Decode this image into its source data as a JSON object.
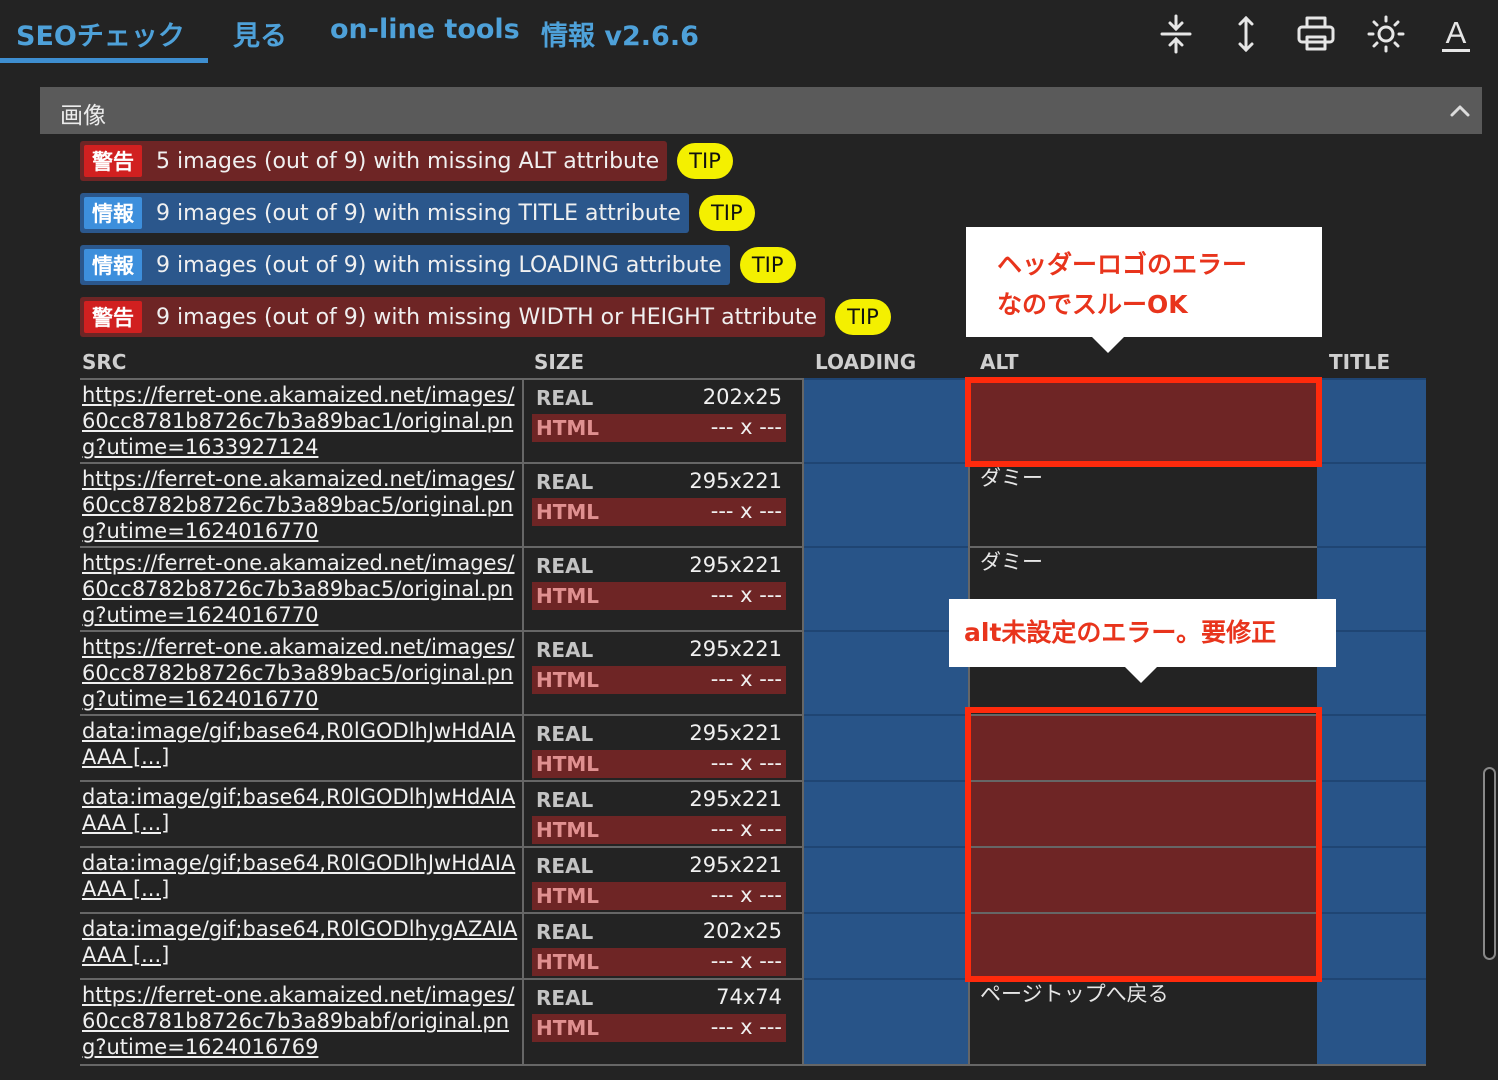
{
  "tabs": [
    "SEOチェック",
    "見る",
    "on-line tools",
    "情報 v2.6.6"
  ],
  "toolbar": [
    "collapse-vertical-icon",
    "expand-vertical-icon",
    "print-icon",
    "brightness-icon",
    "font-icon"
  ],
  "toolbar_font_glyph": "A",
  "section": {
    "title": "画像"
  },
  "messages": [
    {
      "type": "warn",
      "badge": "警告",
      "text": "5 images (out of 9) with missing ALT attribute",
      "tip": "TIP"
    },
    {
      "type": "info",
      "badge": "情報",
      "text": "9 images (out of 9) with missing TITLE attribute",
      "tip": "TIP"
    },
    {
      "type": "info",
      "badge": "情報",
      "text": "9 images (out of 9) with missing LOADING attribute",
      "tip": "TIP"
    },
    {
      "type": "warn",
      "badge": "警告",
      "text": "9 images (out of 9) with missing WIDTH or HEIGHT attribute",
      "tip": "TIP"
    }
  ],
  "table": {
    "headers": {
      "src": "SRC",
      "size": "SIZE",
      "loading": "LOADING",
      "alt": "ALT",
      "title": "TITLE"
    },
    "size_labels": {
      "real": "REAL",
      "html": "HTML"
    },
    "rows": [
      {
        "src": "https://ferret-one.akamaized.net/images/60cc8781b8726c7b3a89bac1/original.png?utime=1633927124",
        "real": "202x25",
        "html": "--- x ---",
        "alt": ""
      },
      {
        "src": "https://ferret-one.akamaized.net/images/60cc8782b8726c7b3a89bac5/original.png?utime=1624016770",
        "real": "295x221",
        "html": "--- x ---",
        "alt": "ダミー"
      },
      {
        "src": "https://ferret-one.akamaized.net/images/60cc8782b8726c7b3a89bac5/original.png?utime=1624016770",
        "real": "295x221",
        "html": "--- x ---",
        "alt": "ダミー"
      },
      {
        "src": "https://ferret-one.akamaized.net/images/60cc8782b8726c7b3a89bac5/original.png?utime=1624016770",
        "real": "295x221",
        "html": "--- x ---",
        "alt": ""
      },
      {
        "src": "data:image/gif;base64,R0lGODlhJwHdAIAAAA [...]",
        "real": "295x221",
        "html": "--- x ---",
        "alt": ""
      },
      {
        "src": "data:image/gif;base64,R0lGODlhJwHdAIAAAA [...]",
        "real": "295x221",
        "html": "--- x ---",
        "alt": ""
      },
      {
        "src": "data:image/gif;base64,R0lGODlhJwHdAIAAAA [...]",
        "real": "295x221",
        "html": "--- x ---",
        "alt": ""
      },
      {
        "src": "data:image/gif;base64,R0lGODlhygAZAIAAAA [...]",
        "real": "202x25",
        "html": "--- x ---",
        "alt": ""
      },
      {
        "src": "https://ferret-one.akamaized.net/images/60cc8781b8726c7b3a89babf/original.png?utime=1624016769",
        "real": "74x74",
        "html": "--- x ---",
        "alt": "ページトップへ戻る"
      }
    ]
  },
  "annotations": {
    "callout1": [
      "ヘッダーロゴのエラー",
      "なのでスルーOK"
    ],
    "callout2": "alt未設定のエラー。要修正"
  },
  "colors": {
    "accent": "#4ea1d9",
    "warn": "#6e2525",
    "info": "#2b578c",
    "tip": "#f4f000",
    "annotation": "#ff2a0c"
  }
}
